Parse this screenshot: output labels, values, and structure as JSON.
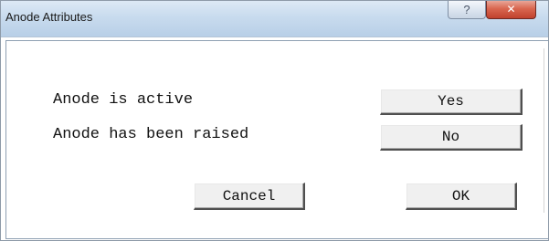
{
  "window": {
    "title": "Anode Attributes",
    "help_glyph": "?",
    "close_glyph": "✕"
  },
  "attributes": [
    {
      "label": "Anode is active",
      "value": "Yes"
    },
    {
      "label": "Anode has been raised",
      "value": "No"
    }
  ],
  "actions": {
    "cancel_label": "Cancel",
    "ok_label": "OK"
  }
}
